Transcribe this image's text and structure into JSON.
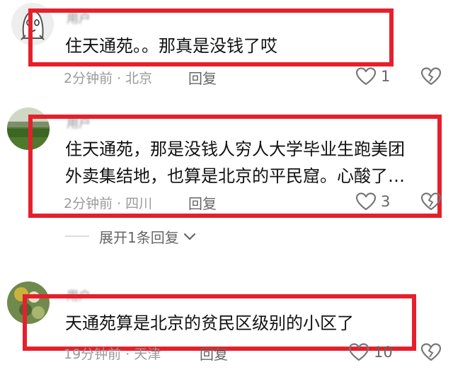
{
  "comments": [
    {
      "username": "用户",
      "text_lines": [
        "住天通苑。。那真是没钱了哎"
      ],
      "time": "2分钟前",
      "location": "北京",
      "reply_label": "回复",
      "likes": "1"
    },
    {
      "username": "用户",
      "text_lines": [
        "住天通苑，那是没钱人穷人大学毕业生跑美团",
        "外卖集结地，也算是北京的平民窟。心酸了…"
      ],
      "time": "2分钟前",
      "location": "四川",
      "reply_label": "回复",
      "likes": "3"
    },
    {
      "username": "用户",
      "text_lines": [
        "天通苑算是北京的贫民区级别的小区了"
      ],
      "time": "19分钟前",
      "location": "天津",
      "reply_label": "回复",
      "likes": "10"
    }
  ],
  "expand_replies": "展开1条回复",
  "colors": {
    "highlight": "#e5202c",
    "meta_text": "#9a9a9a",
    "divider": "#dcdcdc"
  },
  "icons": {
    "like": "heart-outline-icon",
    "dislike": "broken-heart-icon",
    "expand": "chevron-down-icon"
  }
}
